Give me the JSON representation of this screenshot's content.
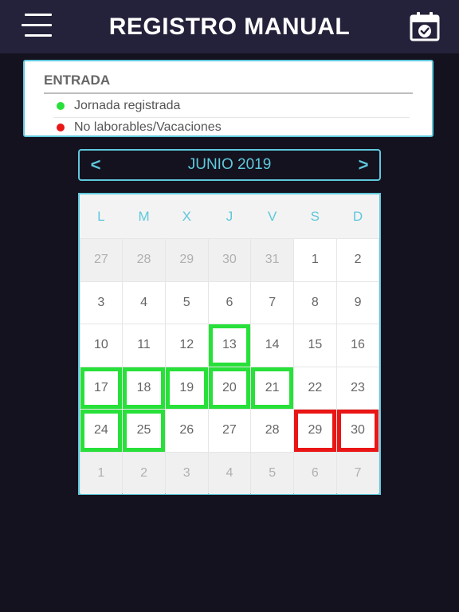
{
  "header": {
    "title": "REGISTRO MANUAL"
  },
  "legend": {
    "title": "ENTRADA",
    "items": [
      {
        "label": "Jornada registrada",
        "color": "#28e03a"
      },
      {
        "label": "No laborables/Vacaciones",
        "color": "#ea1616"
      }
    ]
  },
  "calendar": {
    "month_label": "JUNIO 2019",
    "prev": "<",
    "next": ">",
    "weekdays": [
      "L",
      "M",
      "X",
      "J",
      "V",
      "S",
      "D"
    ],
    "days": [
      {
        "label": "27",
        "state": "out"
      },
      {
        "label": "28",
        "state": "out"
      },
      {
        "label": "29",
        "state": "out"
      },
      {
        "label": "30",
        "state": "out"
      },
      {
        "label": "31",
        "state": "out"
      },
      {
        "label": "1",
        "state": "none"
      },
      {
        "label": "2",
        "state": "none"
      },
      {
        "label": "3",
        "state": "none"
      },
      {
        "label": "4",
        "state": "none"
      },
      {
        "label": "5",
        "state": "none"
      },
      {
        "label": "6",
        "state": "none"
      },
      {
        "label": "7",
        "state": "none"
      },
      {
        "label": "8",
        "state": "none"
      },
      {
        "label": "9",
        "state": "none"
      },
      {
        "label": "10",
        "state": "none"
      },
      {
        "label": "11",
        "state": "none"
      },
      {
        "label": "12",
        "state": "none"
      },
      {
        "label": "13",
        "state": "registered"
      },
      {
        "label": "14",
        "state": "none"
      },
      {
        "label": "15",
        "state": "none"
      },
      {
        "label": "16",
        "state": "none"
      },
      {
        "label": "17",
        "state": "registered"
      },
      {
        "label": "18",
        "state": "registered"
      },
      {
        "label": "19",
        "state": "registered"
      },
      {
        "label": "20",
        "state": "registered"
      },
      {
        "label": "21",
        "state": "registered"
      },
      {
        "label": "22",
        "state": "none"
      },
      {
        "label": "23",
        "state": "none"
      },
      {
        "label": "24",
        "state": "registered"
      },
      {
        "label": "25",
        "state": "registered"
      },
      {
        "label": "26",
        "state": "none"
      },
      {
        "label": "27",
        "state": "none"
      },
      {
        "label": "28",
        "state": "none"
      },
      {
        "label": "29",
        "state": "holiday"
      },
      {
        "label": "30",
        "state": "holiday"
      },
      {
        "label": "1",
        "state": "out"
      },
      {
        "label": "2",
        "state": "out"
      },
      {
        "label": "3",
        "state": "out"
      },
      {
        "label": "4",
        "state": "out"
      },
      {
        "label": "5",
        "state": "out"
      },
      {
        "label": "6",
        "state": "out"
      },
      {
        "label": "7",
        "state": "out"
      }
    ]
  }
}
